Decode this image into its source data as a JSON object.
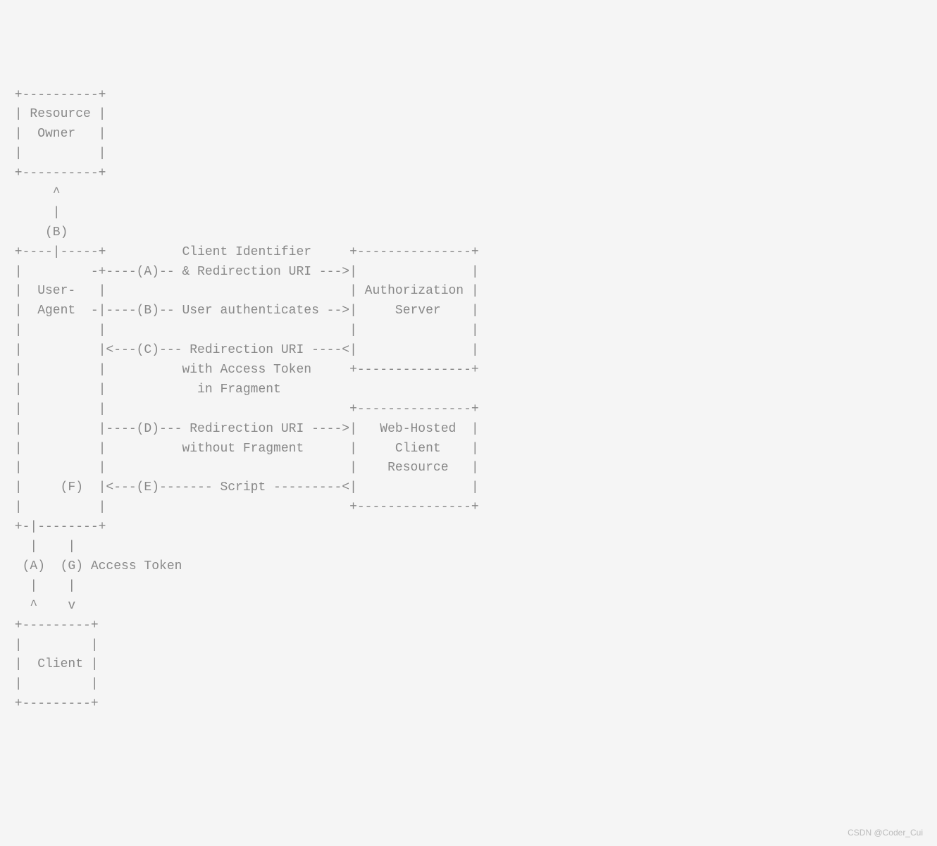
{
  "diagram": {
    "lines": [
      " +----------+",
      " | Resource |",
      " |  Owner   |",
      " |          |",
      " +----------+",
      "      ^",
      "      |",
      "     (B)",
      " +----|-----+          Client Identifier     +---------------+",
      " |         -+----(A)-- & Redirection URI --->|               |",
      " |  User-   |                                | Authorization |",
      " |  Agent  -|----(B)-- User authenticates -->|     Server    |",
      " |          |                                |               |",
      " |          |<---(C)--- Redirection URI ----<|               |",
      " |          |          with Access Token     +---------------+",
      " |          |            in Fragment",
      " |          |                                +---------------+",
      " |          |----(D)--- Redirection URI ---->|   Web-Hosted  |",
      " |          |          without Fragment      |     Client    |",
      " |          |                                |    Resource   |",
      " |     (F)  |<---(E)------- Script ---------<|               |",
      " |          |                                +---------------+",
      " +-|--------+",
      "   |    |",
      "  (A)  (G) Access Token",
      "   |    |",
      "   ^    v",
      " +---------+",
      " |         |",
      " |  Client |",
      " |         |",
      " +---------+"
    ]
  },
  "watermark": "CSDN @Coder_Cui"
}
